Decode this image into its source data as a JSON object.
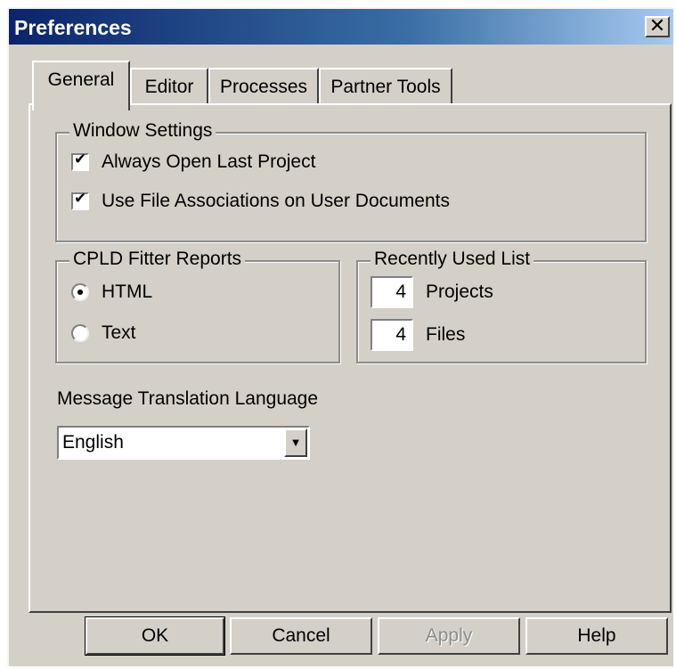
{
  "window": {
    "title": "Preferences",
    "close_glyph": "✕"
  },
  "tabs": [
    {
      "label": "General",
      "active": true
    },
    {
      "label": "Editor",
      "active": false
    },
    {
      "label": "Processes",
      "active": false
    },
    {
      "label": "Partner Tools",
      "active": false
    }
  ],
  "window_settings": {
    "label": "Window Settings",
    "options": [
      {
        "label": "Always Open Last Project",
        "checked": true
      },
      {
        "label": "Use File Associations on User Documents",
        "checked": true
      }
    ]
  },
  "cpld_reports": {
    "label": "CPLD Fitter Reports",
    "options": [
      {
        "label": "HTML",
        "selected": true
      },
      {
        "label": "Text",
        "selected": false
      }
    ]
  },
  "recently_used": {
    "label": "Recently Used List",
    "projects": {
      "value": "4",
      "label": "Projects"
    },
    "files": {
      "value": "4",
      "label": "Files"
    }
  },
  "language": {
    "label": "Message Translation Language",
    "selected": "English",
    "arrow_icon": "▼"
  },
  "buttons": {
    "ok": "OK",
    "cancel": "Cancel",
    "apply": "Apply",
    "help": "Help"
  },
  "colors": {
    "face": "#d4d0c8",
    "titlebar": "#0a246a"
  },
  "icons": {
    "check": "✔"
  }
}
